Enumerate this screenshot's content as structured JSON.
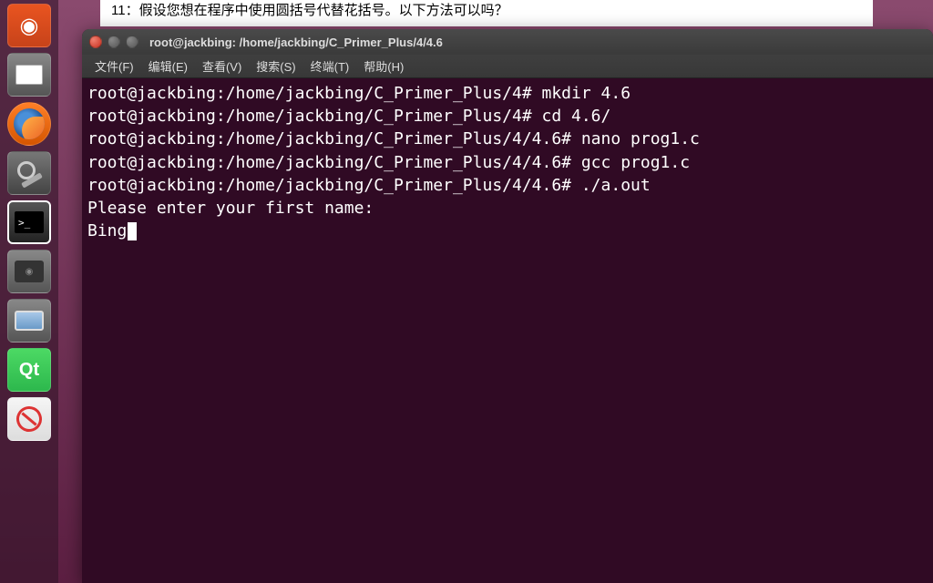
{
  "background_doc": {
    "text": "11：假设您想在程序中使用圆括号代替花括号。以下方法可以吗？"
  },
  "window": {
    "title": "root@jackbing: /home/jackbing/C_Primer_Plus/4/4.6"
  },
  "menubar": {
    "file": "文件(F)",
    "edit": "编辑(E)",
    "view": "查看(V)",
    "search": "搜索(S)",
    "terminal": "终端(T)",
    "help": "帮助(H)"
  },
  "terminal": {
    "lines": [
      "root@jackbing:/home/jackbing/C_Primer_Plus/4# mkdir 4.6",
      "root@jackbing:/home/jackbing/C_Primer_Plus/4# cd 4.6/",
      "root@jackbing:/home/jackbing/C_Primer_Plus/4/4.6# nano prog1.c",
      "root@jackbing:/home/jackbing/C_Primer_Plus/4/4.6# gcc prog1.c",
      "root@jackbing:/home/jackbing/C_Primer_Plus/4/4.6# ./a.out",
      "Please enter your first name:"
    ],
    "input_line": "Bing"
  },
  "launcher": {
    "items": [
      "ubuntu",
      "files",
      "firefox",
      "settings",
      "terminal",
      "media",
      "monitor",
      "qt",
      "pdf"
    ]
  }
}
